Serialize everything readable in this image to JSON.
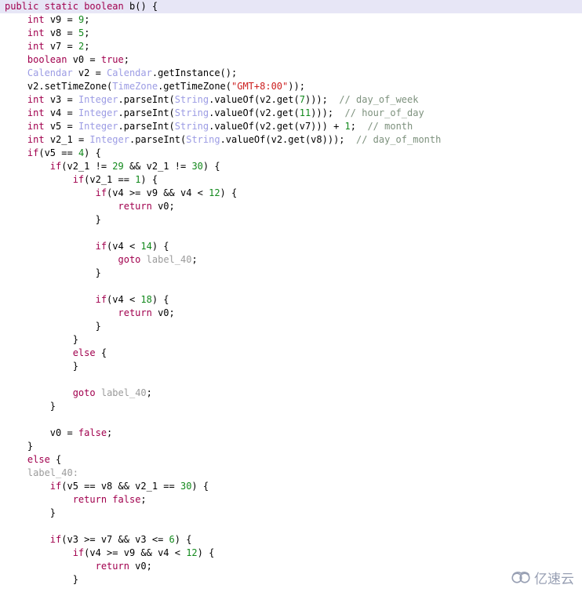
{
  "viewer": {
    "title": "decompiled-java-code-view",
    "language": "java",
    "background": "#ffffff",
    "highlight_color": "#e7e6f6"
  },
  "theme": {
    "keyword": "#a1004e",
    "class_name": "#9c9ce4",
    "number": "#12891c",
    "string": "#cc2020",
    "comment": "#7d917d",
    "label": "#9b9b9b",
    "plain": "#000000",
    "watermark": "#868fa6"
  },
  "watermark": {
    "icon": "cloud-icon",
    "text": "亿速云"
  },
  "code": {
    "lines": [
      {
        "highlight": true,
        "indent": 0,
        "tokens": [
          {
            "t": "kw",
            "v": "public"
          },
          {
            "t": "pln",
            "v": " "
          },
          {
            "t": "kw",
            "v": "static"
          },
          {
            "t": "pln",
            "v": " "
          },
          {
            "t": "kw",
            "v": "boolean"
          },
          {
            "t": "pln",
            "v": " b() {"
          }
        ]
      },
      {
        "highlight": false,
        "indent": 1,
        "tokens": [
          {
            "t": "kw",
            "v": "int"
          },
          {
            "t": "pln",
            "v": " v9 = "
          },
          {
            "t": "num",
            "v": "9"
          },
          {
            "t": "pln",
            "v": ";"
          }
        ]
      },
      {
        "highlight": false,
        "indent": 1,
        "tokens": [
          {
            "t": "kw",
            "v": "int"
          },
          {
            "t": "pln",
            "v": " v8 = "
          },
          {
            "t": "num",
            "v": "5"
          },
          {
            "t": "pln",
            "v": ";"
          }
        ]
      },
      {
        "highlight": false,
        "indent": 1,
        "tokens": [
          {
            "t": "kw",
            "v": "int"
          },
          {
            "t": "pln",
            "v": " v7 = "
          },
          {
            "t": "num",
            "v": "2"
          },
          {
            "t": "pln",
            "v": ";"
          }
        ]
      },
      {
        "highlight": false,
        "indent": 1,
        "tokens": [
          {
            "t": "kw",
            "v": "boolean"
          },
          {
            "t": "pln",
            "v": " v0 = "
          },
          {
            "t": "kw",
            "v": "true"
          },
          {
            "t": "pln",
            "v": ";"
          }
        ]
      },
      {
        "highlight": false,
        "indent": 1,
        "tokens": [
          {
            "t": "cls",
            "v": "Calendar"
          },
          {
            "t": "pln",
            "v": " v2 = "
          },
          {
            "t": "cls",
            "v": "Calendar"
          },
          {
            "t": "pln",
            "v": ".getInstance();"
          }
        ]
      },
      {
        "highlight": false,
        "indent": 1,
        "tokens": [
          {
            "t": "pln",
            "v": "v2.setTimeZone("
          },
          {
            "t": "cls",
            "v": "TimeZone"
          },
          {
            "t": "pln",
            "v": ".getTimeZone("
          },
          {
            "t": "str",
            "v": "\"GMT+8:00\""
          },
          {
            "t": "pln",
            "v": "));"
          }
        ]
      },
      {
        "highlight": false,
        "indent": 1,
        "tokens": [
          {
            "t": "kw",
            "v": "int"
          },
          {
            "t": "pln",
            "v": " v3 = "
          },
          {
            "t": "cls",
            "v": "Integer"
          },
          {
            "t": "pln",
            "v": ".parseInt("
          },
          {
            "t": "cls",
            "v": "String"
          },
          {
            "t": "pln",
            "v": ".valueOf(v2.get("
          },
          {
            "t": "num",
            "v": "7"
          },
          {
            "t": "pln",
            "v": ")));  "
          },
          {
            "t": "cmt",
            "v": "// day_of_week"
          }
        ]
      },
      {
        "highlight": false,
        "indent": 1,
        "tokens": [
          {
            "t": "kw",
            "v": "int"
          },
          {
            "t": "pln",
            "v": " v4 = "
          },
          {
            "t": "cls",
            "v": "Integer"
          },
          {
            "t": "pln",
            "v": ".parseInt("
          },
          {
            "t": "cls",
            "v": "String"
          },
          {
            "t": "pln",
            "v": ".valueOf(v2.get("
          },
          {
            "t": "num",
            "v": "11"
          },
          {
            "t": "pln",
            "v": ")));  "
          },
          {
            "t": "cmt",
            "v": "// hour_of_day"
          }
        ]
      },
      {
        "highlight": false,
        "indent": 1,
        "tokens": [
          {
            "t": "kw",
            "v": "int"
          },
          {
            "t": "pln",
            "v": " v5 = "
          },
          {
            "t": "cls",
            "v": "Integer"
          },
          {
            "t": "pln",
            "v": ".parseInt("
          },
          {
            "t": "cls",
            "v": "String"
          },
          {
            "t": "pln",
            "v": ".valueOf(v2.get(v7))) + "
          },
          {
            "t": "num",
            "v": "1"
          },
          {
            "t": "pln",
            "v": ";  "
          },
          {
            "t": "cmt",
            "v": "// month"
          }
        ]
      },
      {
        "highlight": false,
        "indent": 1,
        "tokens": [
          {
            "t": "kw",
            "v": "int"
          },
          {
            "t": "pln",
            "v": " v2_1 = "
          },
          {
            "t": "cls",
            "v": "Integer"
          },
          {
            "t": "pln",
            "v": ".parseInt("
          },
          {
            "t": "cls",
            "v": "String"
          },
          {
            "t": "pln",
            "v": ".valueOf(v2.get(v8)));  "
          },
          {
            "t": "cmt",
            "v": "// day_of_month"
          }
        ]
      },
      {
        "highlight": false,
        "indent": 1,
        "tokens": [
          {
            "t": "kw",
            "v": "if"
          },
          {
            "t": "pln",
            "v": "(v5 == "
          },
          {
            "t": "num",
            "v": "4"
          },
          {
            "t": "pln",
            "v": ") {"
          }
        ]
      },
      {
        "highlight": false,
        "indent": 2,
        "tokens": [
          {
            "t": "kw",
            "v": "if"
          },
          {
            "t": "pln",
            "v": "(v2_1 != "
          },
          {
            "t": "num",
            "v": "29"
          },
          {
            "t": "pln",
            "v": " && v2_1 != "
          },
          {
            "t": "num",
            "v": "30"
          },
          {
            "t": "pln",
            "v": ") {"
          }
        ]
      },
      {
        "highlight": false,
        "indent": 3,
        "tokens": [
          {
            "t": "kw",
            "v": "if"
          },
          {
            "t": "pln",
            "v": "(v2_1 == "
          },
          {
            "t": "num",
            "v": "1"
          },
          {
            "t": "pln",
            "v": ") {"
          }
        ]
      },
      {
        "highlight": false,
        "indent": 4,
        "tokens": [
          {
            "t": "kw",
            "v": "if"
          },
          {
            "t": "pln",
            "v": "(v4 >= v9 && v4 < "
          },
          {
            "t": "num",
            "v": "12"
          },
          {
            "t": "pln",
            "v": ") {"
          }
        ]
      },
      {
        "highlight": false,
        "indent": 5,
        "tokens": [
          {
            "t": "kw",
            "v": "return"
          },
          {
            "t": "pln",
            "v": " v0;"
          }
        ]
      },
      {
        "highlight": false,
        "indent": 4,
        "tokens": [
          {
            "t": "pln",
            "v": "}"
          }
        ]
      },
      {
        "highlight": false,
        "indent": 0,
        "tokens": []
      },
      {
        "highlight": false,
        "indent": 4,
        "tokens": [
          {
            "t": "kw",
            "v": "if"
          },
          {
            "t": "pln",
            "v": "(v4 < "
          },
          {
            "t": "num",
            "v": "14"
          },
          {
            "t": "pln",
            "v": ") {"
          }
        ]
      },
      {
        "highlight": false,
        "indent": 5,
        "tokens": [
          {
            "t": "kw",
            "v": "goto"
          },
          {
            "t": "pln",
            "v": " "
          },
          {
            "t": "lbl",
            "v": "label_40"
          },
          {
            "t": "pln",
            "v": ";"
          }
        ]
      },
      {
        "highlight": false,
        "indent": 4,
        "tokens": [
          {
            "t": "pln",
            "v": "}"
          }
        ]
      },
      {
        "highlight": false,
        "indent": 0,
        "tokens": []
      },
      {
        "highlight": false,
        "indent": 4,
        "tokens": [
          {
            "t": "kw",
            "v": "if"
          },
          {
            "t": "pln",
            "v": "(v4 < "
          },
          {
            "t": "num",
            "v": "18"
          },
          {
            "t": "pln",
            "v": ") {"
          }
        ]
      },
      {
        "highlight": false,
        "indent": 5,
        "tokens": [
          {
            "t": "kw",
            "v": "return"
          },
          {
            "t": "pln",
            "v": " v0;"
          }
        ]
      },
      {
        "highlight": false,
        "indent": 4,
        "tokens": [
          {
            "t": "pln",
            "v": "}"
          }
        ]
      },
      {
        "highlight": false,
        "indent": 3,
        "tokens": [
          {
            "t": "pln",
            "v": "}"
          }
        ]
      },
      {
        "highlight": false,
        "indent": 3,
        "tokens": [
          {
            "t": "kw",
            "v": "else"
          },
          {
            "t": "pln",
            "v": " {"
          }
        ]
      },
      {
        "highlight": false,
        "indent": 3,
        "tokens": [
          {
            "t": "pln",
            "v": "}"
          }
        ]
      },
      {
        "highlight": false,
        "indent": 0,
        "tokens": []
      },
      {
        "highlight": false,
        "indent": 3,
        "tokens": [
          {
            "t": "kw",
            "v": "goto"
          },
          {
            "t": "pln",
            "v": " "
          },
          {
            "t": "lbl",
            "v": "label_40"
          },
          {
            "t": "pln",
            "v": ";"
          }
        ]
      },
      {
        "highlight": false,
        "indent": 2,
        "tokens": [
          {
            "t": "pln",
            "v": "}"
          }
        ]
      },
      {
        "highlight": false,
        "indent": 0,
        "tokens": []
      },
      {
        "highlight": false,
        "indent": 2,
        "tokens": [
          {
            "t": "pln",
            "v": "v0 = "
          },
          {
            "t": "kw",
            "v": "false"
          },
          {
            "t": "pln",
            "v": ";"
          }
        ]
      },
      {
        "highlight": false,
        "indent": 1,
        "tokens": [
          {
            "t": "pln",
            "v": "}"
          }
        ]
      },
      {
        "highlight": false,
        "indent": 1,
        "tokens": [
          {
            "t": "kw",
            "v": "else"
          },
          {
            "t": "pln",
            "v": " {"
          }
        ]
      },
      {
        "highlight": false,
        "indent": 1,
        "tokens": [
          {
            "t": "lbl",
            "v": "label_40:"
          }
        ]
      },
      {
        "highlight": false,
        "indent": 2,
        "tokens": [
          {
            "t": "kw",
            "v": "if"
          },
          {
            "t": "pln",
            "v": "(v5 == v8 && v2_1 == "
          },
          {
            "t": "num",
            "v": "30"
          },
          {
            "t": "pln",
            "v": ") {"
          }
        ]
      },
      {
        "highlight": false,
        "indent": 3,
        "tokens": [
          {
            "t": "kw",
            "v": "return"
          },
          {
            "t": "pln",
            "v": " "
          },
          {
            "t": "kw",
            "v": "false"
          },
          {
            "t": "pln",
            "v": ";"
          }
        ]
      },
      {
        "highlight": false,
        "indent": 2,
        "tokens": [
          {
            "t": "pln",
            "v": "}"
          }
        ]
      },
      {
        "highlight": false,
        "indent": 0,
        "tokens": []
      },
      {
        "highlight": false,
        "indent": 2,
        "tokens": [
          {
            "t": "kw",
            "v": "if"
          },
          {
            "t": "pln",
            "v": "(v3 >= v7 && v3 <= "
          },
          {
            "t": "num",
            "v": "6"
          },
          {
            "t": "pln",
            "v": ") {"
          }
        ]
      },
      {
        "highlight": false,
        "indent": 3,
        "tokens": [
          {
            "t": "kw",
            "v": "if"
          },
          {
            "t": "pln",
            "v": "(v4 >= v9 && v4 < "
          },
          {
            "t": "num",
            "v": "12"
          },
          {
            "t": "pln",
            "v": ") {"
          }
        ]
      },
      {
        "highlight": false,
        "indent": 4,
        "tokens": [
          {
            "t": "kw",
            "v": "return"
          },
          {
            "t": "pln",
            "v": " v0;"
          }
        ]
      },
      {
        "highlight": false,
        "indent": 3,
        "tokens": [
          {
            "t": "pln",
            "v": "}"
          }
        ]
      }
    ]
  }
}
